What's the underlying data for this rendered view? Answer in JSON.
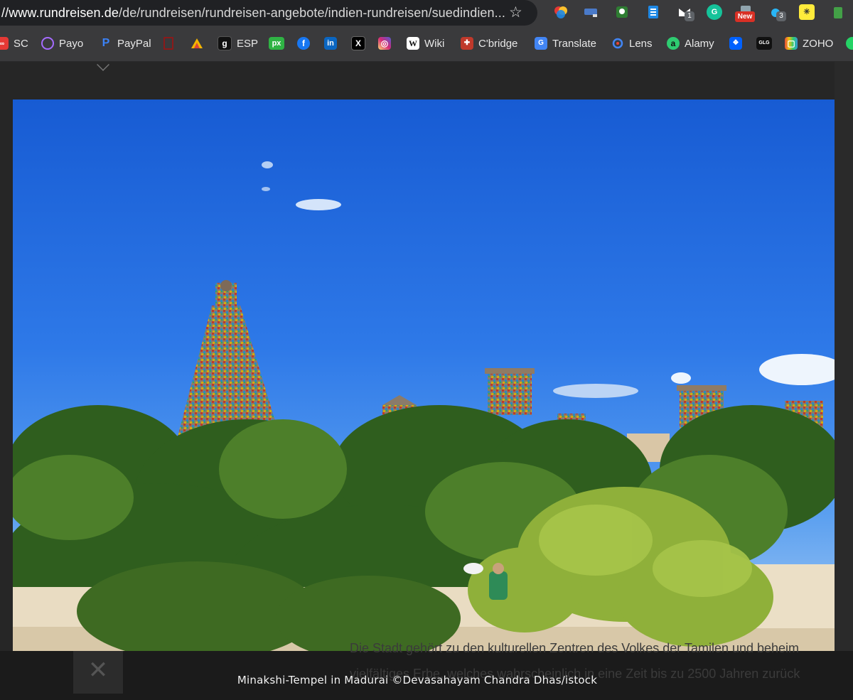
{
  "browser": {
    "url_host": "//www.rundreisen.de",
    "url_path": "/de/rundreisen/rundreisen-angebote/indien-rundreisen/suedindien...",
    "star_icon": "bookmark-star-icon",
    "extensions": {
      "badge_1": "1",
      "badge_new": "New",
      "badge_3": "3"
    }
  },
  "bookmarks": [
    {
      "label": "SC",
      "icon": "sc-icon",
      "color": "#e53935"
    },
    {
      "label": "Payo",
      "icon": "payo-icon",
      "color": "#7b61ff"
    },
    {
      "label": "PayPal",
      "icon": "paypal-icon",
      "color": "#1e5bd7"
    },
    {
      "label": "",
      "icon": "bookmark-red-icon",
      "color": "#b71c1c"
    },
    {
      "label": "",
      "icon": "bookmark-triangle-icon",
      "color": "#f4b400"
    },
    {
      "label": "ESP",
      "icon": "esp-icon",
      "color": "#111111"
    },
    {
      "label": "",
      "icon": "px-icon",
      "color": "#2fb344"
    },
    {
      "label": "",
      "icon": "facebook-icon",
      "color": "#1877f2"
    },
    {
      "label": "",
      "icon": "linkedin-icon",
      "color": "#0a66c2"
    },
    {
      "label": "",
      "icon": "x-icon",
      "color": "#000000"
    },
    {
      "label": "",
      "icon": "instagram-icon",
      "color": "#d62976"
    },
    {
      "label": "Wiki",
      "icon": "wikipedia-icon",
      "color": "#ffffff"
    },
    {
      "label": "C'bridge",
      "icon": "cambridge-icon",
      "color": "#c0392b"
    },
    {
      "label": "Translate",
      "icon": "google-translate-icon",
      "color": "#4285f4"
    },
    {
      "label": "Lens",
      "icon": "google-lens-icon",
      "color": "#4285f4"
    },
    {
      "label": "Alamy",
      "icon": "alamy-icon",
      "color": "#2ecc71"
    },
    {
      "label": "",
      "icon": "dropbox-icon",
      "color": "#0061ff"
    },
    {
      "label": "",
      "icon": "glg-icon",
      "color": "#111111"
    },
    {
      "label": "ZOHO",
      "icon": "zoho-icon",
      "color": "#e74c3c"
    }
  ],
  "lightbox": {
    "caption": "Minakshi-Tempel in Madurai ©Devasahayam Chandra Dhas/istock",
    "close_icon": "close-icon",
    "image_subject": "minakshi-temple-photo"
  },
  "background_page": {
    "text_line_1": "Die Stadt gehört zu den kulturellen Zentren des Volkes der Tamilen und beheim",
    "text_line_2": "vielfältiges Erbe, welches wahrscheinlich in eine Zeit bis zu 2500 Jahren zurück"
  }
}
